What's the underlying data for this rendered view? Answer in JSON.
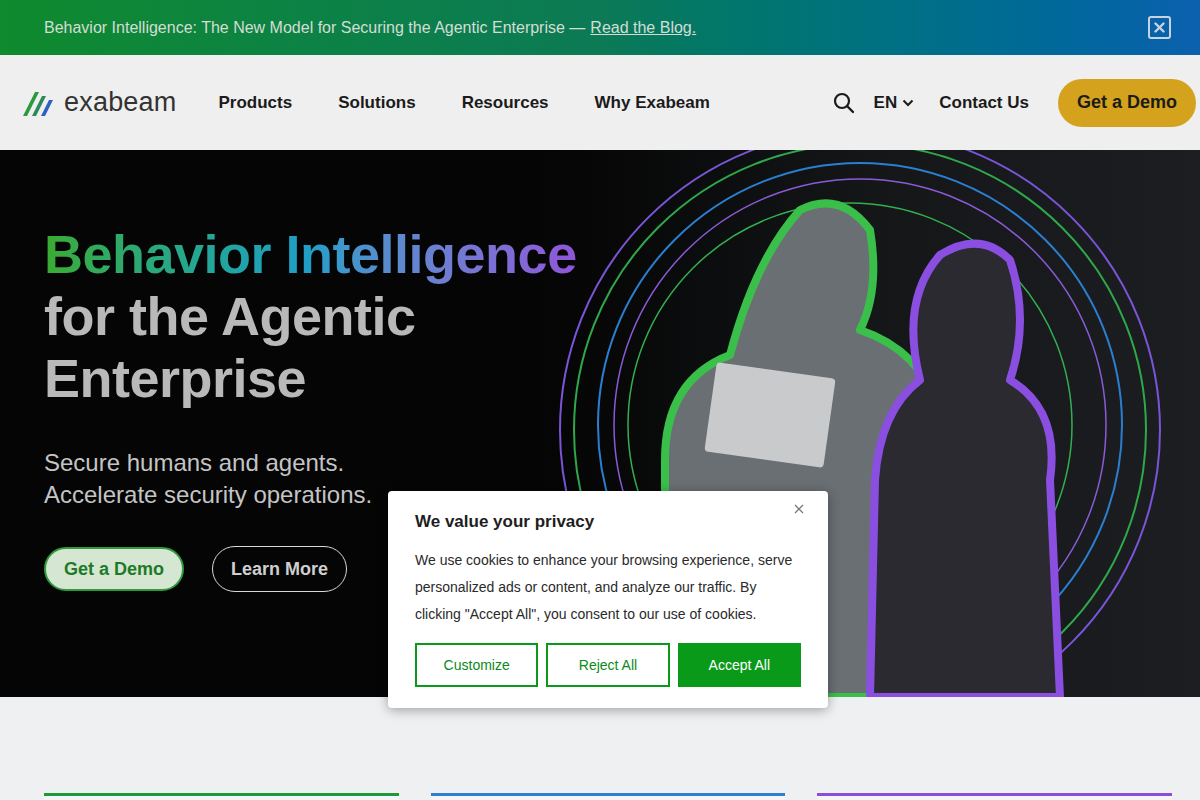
{
  "banner": {
    "text": "Behavior Intelligence: The New Model for Securing the Agentic Enterprise —",
    "link": "Read the Blog."
  },
  "logo": "exabeam",
  "nav": {
    "items": [
      "Products",
      "Solutions",
      "Resources",
      "Why Exabeam"
    ],
    "language": "EN",
    "contact": "Contact Us",
    "cta": "Get a Demo"
  },
  "hero": {
    "title_highlight": "Behavior Intelligence",
    "title_lines": [
      "for the Agentic",
      "Enterprise"
    ],
    "subtitle_lines": [
      "Secure humans and agents.",
      "Accelerate security operations."
    ],
    "buttons": [
      {
        "label": "Get a Demo",
        "kind": "primary"
      },
      {
        "label": "Learn More",
        "kind": "outline"
      }
    ]
  },
  "cards": [
    {
      "color": "#1f9a3a"
    },
    {
      "color": "#2f7fd0"
    },
    {
      "color": "#8a4fd8"
    }
  ],
  "cookie": {
    "title": "We value your privacy",
    "text": "We use cookies to enhance your browsing experience, serve personalized ads or content, and analyze our traffic. By clicking \"Accept All\", you consent to our use of cookies.",
    "buttons": [
      {
        "label": "Customize",
        "kind": "outline"
      },
      {
        "label": "Reject All",
        "kind": "outline"
      },
      {
        "label": "Accept All",
        "kind": "primary"
      }
    ]
  }
}
